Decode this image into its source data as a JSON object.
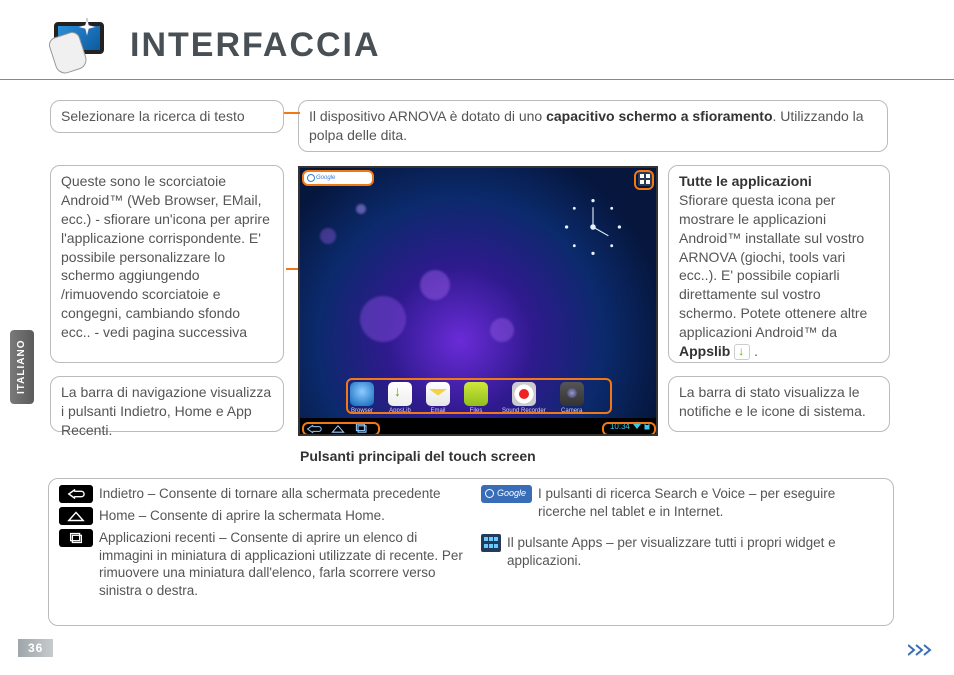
{
  "page": {
    "title": "INTERFACCIA",
    "lang_tab": "ITALIANO",
    "number": "36"
  },
  "boxes": {
    "search": "Selezionare la ricerca di testo",
    "device_pre": "Il dispositivo ARNOVA è dotato di uno ",
    "device_bold": "capacitivo schermo a sfioramento",
    "device_post": ". Utilizzando la polpa delle dita.",
    "shortcuts": "Queste sono le scorciatoie Android™ (Web Browser, EMail, ecc.) - sfiorare un'icona per aprire l'applicazione corrispondente. E' possibile personalizzare lo schermo aggiungendo /rimuovendo scorciatoie e congegni, cambiando sfondo ecc.. - vedi pagina successiva",
    "navbar": "La barra di navigazione visualizza i pulsanti Indietro, Home e App Recenti.",
    "apps_head": "Tutte le applicazioni",
    "apps_body_1": "Sfiorare questa icona per mostrare le applicazioni Android™ installate sul vostro ARNOVA (giochi, tools vari ecc..). E' possibile copiarli direttamente sul vostro schermo. Potete ottenere altre applicazioni Android™ da ",
    "apps_body_bold": "Appslib",
    "apps_body_2": " .",
    "status": "La barra di stato visualizza le notifiche e le icone di sistema."
  },
  "screenshot": {
    "search_label": "Google",
    "time": "10:34",
    "dock": [
      {
        "label": "Browser"
      },
      {
        "label": "AppsLib"
      },
      {
        "label": "Email"
      },
      {
        "label": "Files"
      },
      {
        "label": "Sound Recorder"
      },
      {
        "label": "Camera"
      }
    ]
  },
  "subhead": "Pulsanti principali del touch screen",
  "legend": {
    "back": "Indietro – Consente di tornare alla schermata precedente",
    "home": "Home – Consente di aprire la schermata Home.",
    "recent": "Applicazioni recenti – Consente di aprire un elenco di immagini in miniatura di applicazioni utilizzate di recente. Per rimuovere una miniatura dall'elenco, farla scorrere verso sinistra o destra.",
    "search": "I pulsanti di ricerca Search e Voice – per eseguire ricerche nel tablet e in Internet.",
    "apps": "Il pulsante Apps – per visualizzare tutti i propri widget e applicazioni.",
    "search_chip": "Google"
  }
}
